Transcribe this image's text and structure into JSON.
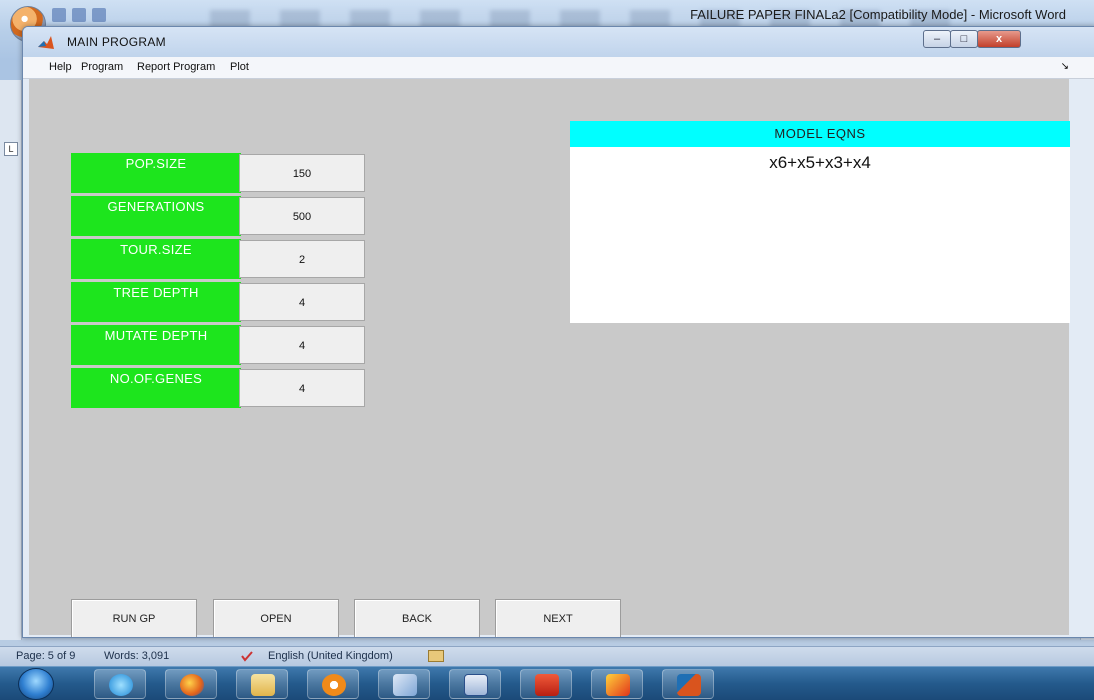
{
  "word": {
    "title": "FAILURE PAPER FINALa2 [Compatibility Mode] - Microsoft Word",
    "status": {
      "page": "Page: 5 of 9",
      "words": "Words: 3,091",
      "language": "English (United Kingdom)"
    }
  },
  "app": {
    "title": "MAIN PROGRAM",
    "window_controls": {
      "minimize": "–",
      "maximize": "□",
      "close": "x"
    },
    "menu": [
      "Help",
      "Program",
      "Report Program",
      "Plot"
    ],
    "params": [
      {
        "label": "POP.SIZE",
        "value": "150"
      },
      {
        "label": "GENERATIONS",
        "value": "500"
      },
      {
        "label": "TOUR.SIZE",
        "value": "2"
      },
      {
        "label": "TREE DEPTH",
        "value": "4"
      },
      {
        "label": "MUTATE DEPTH",
        "value": "4"
      },
      {
        "label": "NO.OF.GENES",
        "value": "4"
      }
    ],
    "model": {
      "header": "MODEL EQNS",
      "equation": "x6+x5+x3+x4"
    },
    "buttons": [
      "RUN GP",
      "OPEN",
      "BACK",
      "NEXT"
    ]
  },
  "colors": {
    "param_label_bg": "#1de51d",
    "model_header_bg": "#00ffff",
    "panel_bg": "#c9c9c9"
  },
  "icons": {
    "office_button": "office-orb-icon",
    "app": "matlab-icon",
    "start": "windows-start-icon",
    "taskbar": [
      "internet-explorer-icon",
      "firefox-icon",
      "file-explorer-icon",
      "media-player-icon",
      "email-icon",
      "word-icon",
      "acrobat-icon",
      "winamp-icon",
      "matlab-icon"
    ]
  }
}
